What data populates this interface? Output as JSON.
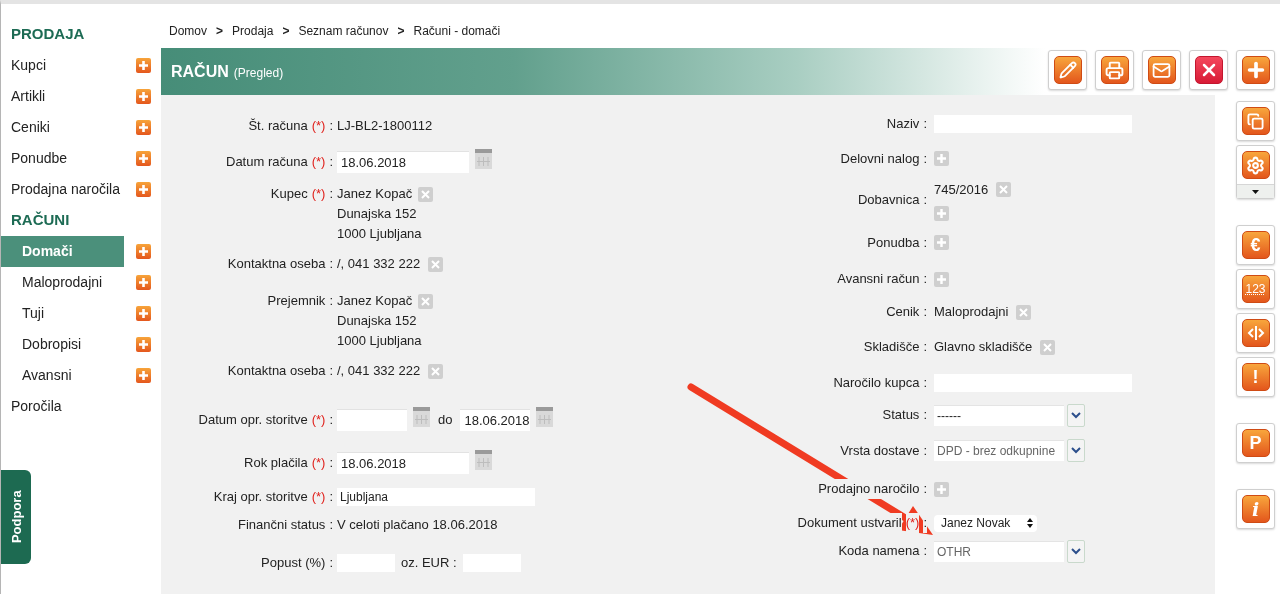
{
  "breadcrumb": [
    {
      "kind": "link",
      "label": "Domov"
    },
    {
      "kind": "separator",
      "label": ">"
    },
    {
      "kind": "link",
      "label": "Prodaja"
    },
    {
      "kind": "separator",
      "label": ">"
    },
    {
      "kind": "link",
      "label": "Seznam računov"
    },
    {
      "kind": "separator",
      "label": ">"
    },
    {
      "kind": "link",
      "label": "Računi - domači"
    }
  ],
  "sidebar": [
    {
      "kind": "heading",
      "label": "PRODAJA"
    },
    {
      "kind": "item",
      "label": "Kupci",
      "selected": false
    },
    {
      "kind": "item",
      "label": "Artikli",
      "selected": false
    },
    {
      "kind": "item",
      "label": "Ceniki",
      "selected": false
    },
    {
      "kind": "item",
      "label": "Ponudbe",
      "selected": false
    },
    {
      "kind": "item",
      "label": "Prodajna naročila",
      "selected": false
    },
    {
      "kind": "heading",
      "label": "RAČUNI"
    },
    {
      "kind": "sub_item",
      "label": "Domači",
      "selected": true
    },
    {
      "kind": "sub_item",
      "label": "Maloprodajni",
      "selected": false
    },
    {
      "kind": "sub_item",
      "label": "Tuji",
      "selected": false
    },
    {
      "kind": "sub_item",
      "label": "Dobropisi",
      "selected": false
    },
    {
      "kind": "sub_item",
      "label": "Avansni",
      "selected": false
    },
    {
      "kind": "link",
      "label": "Poročila",
      "selected": false
    }
  ],
  "support_tab": {
    "label": "Podpora"
  },
  "header": {
    "title": "RAČUN",
    "subtitle": "(Pregled)"
  },
  "toolbar": [
    {
      "kind": "edit"
    },
    {
      "kind": "print"
    },
    {
      "kind": "mail"
    },
    {
      "kind": "delete"
    },
    {
      "kind": "add"
    }
  ],
  "side_toolbar": [
    [
      {
        "kind": "copy",
        "dropdown": false
      },
      {
        "kind": "settings",
        "dropdown": true
      }
    ],
    [
      {
        "kind": "euro",
        "glyph": "€"
      },
      {
        "kind": "numbering",
        "glyph": "123"
      },
      {
        "kind": "split"
      },
      {
        "kind": "alert",
        "glyph": "!"
      }
    ],
    [
      {
        "kind": "parking",
        "glyph": "P"
      }
    ],
    [
      {
        "kind": "info",
        "glyph": "i"
      }
    ]
  ],
  "form": {
    "left": [
      {
        "kind": "text",
        "label": "Št. računa",
        "mark": "(*)",
        "colon": ":",
        "value": "LJ-BL2-1800112"
      },
      {
        "kind": "date",
        "label": "Datum računa",
        "mark": "(*)",
        "colon": ":",
        "value": "18.06.2018"
      },
      {
        "kind": "address",
        "label": "Kupec",
        "mark": "(*)",
        "colon": ":",
        "lines": [
          "Janez Kopač",
          "Dunajska 152",
          "1000 Ljubljana"
        ]
      },
      {
        "kind": "removable",
        "label": "Kontaktna oseba",
        "colon": ":",
        "value": "/, 041 332 222"
      },
      {
        "kind": "address",
        "label": "Prejemnik",
        "colon": ":",
        "lines": [
          "Janez Kopač",
          "Dunajska 152",
          "1000 Ljubljana"
        ]
      },
      {
        "kind": "removable",
        "label": "Kontaktna oseba",
        "colon": ":",
        "value": "/, 041 332 222"
      },
      {
        "kind": "date_range",
        "label": "Datum opr. storitve",
        "mark": "(*)",
        "colon": ":",
        "to_label": "do",
        "to": "18.06.2018"
      },
      {
        "kind": "date",
        "label": "Rok plačila",
        "mark": "(*)",
        "colon": ":",
        "value": "18.06.2018"
      },
      {
        "kind": "input",
        "label": "Kraj opr. storitve",
        "mark": "(*)",
        "colon": ":",
        "value": "Ljubljana"
      },
      {
        "kind": "text",
        "label": "Finančni status",
        "colon": ":",
        "value": "V celoti plačano 18.06.2018"
      },
      {
        "kind": "pair",
        "label": "Popust (%)",
        "colon": ":",
        "second_label": "oz. EUR :"
      }
    ],
    "right": [
      {
        "kind": "input",
        "label": "Naziv",
        "colon": ":"
      },
      {
        "kind": "add",
        "label": "Delovni nalog",
        "colon": ":"
      },
      {
        "kind": "list_add",
        "label": "Dobavnica",
        "colon": ":",
        "items": [
          "745/2016"
        ]
      },
      {
        "kind": "add",
        "label": "Ponudba",
        "colon": ":"
      },
      {
        "kind": "add",
        "label": "Avansni račun",
        "colon": ":"
      },
      {
        "kind": "removable",
        "label": "Cenik",
        "colon": ":",
        "value": "Maloprodajni"
      },
      {
        "kind": "removable",
        "label": "Skladišče",
        "colon": ":",
        "value": "Glavno skladišče"
      },
      {
        "kind": "input",
        "label": "Naročilo kupca",
        "colon": ":"
      },
      {
        "kind": "select",
        "label": "Status",
        "colon": ":",
        "value": "------",
        "disabled": false
      },
      {
        "kind": "select",
        "label": "Vrsta dostave",
        "colon": ":",
        "value": "DPD - brez odkupnine",
        "disabled": true
      },
      {
        "kind": "add",
        "label": "Prodajno naročilo",
        "colon": ":"
      },
      {
        "kind": "spinner",
        "label": "Dokument ustvaril",
        "mark": "(*)",
        "colon": ":",
        "value": "Janez Novak"
      },
      {
        "kind": "select",
        "label": "Koda namena",
        "colon": ":",
        "value": "OTHR",
        "disabled": true
      }
    ]
  }
}
